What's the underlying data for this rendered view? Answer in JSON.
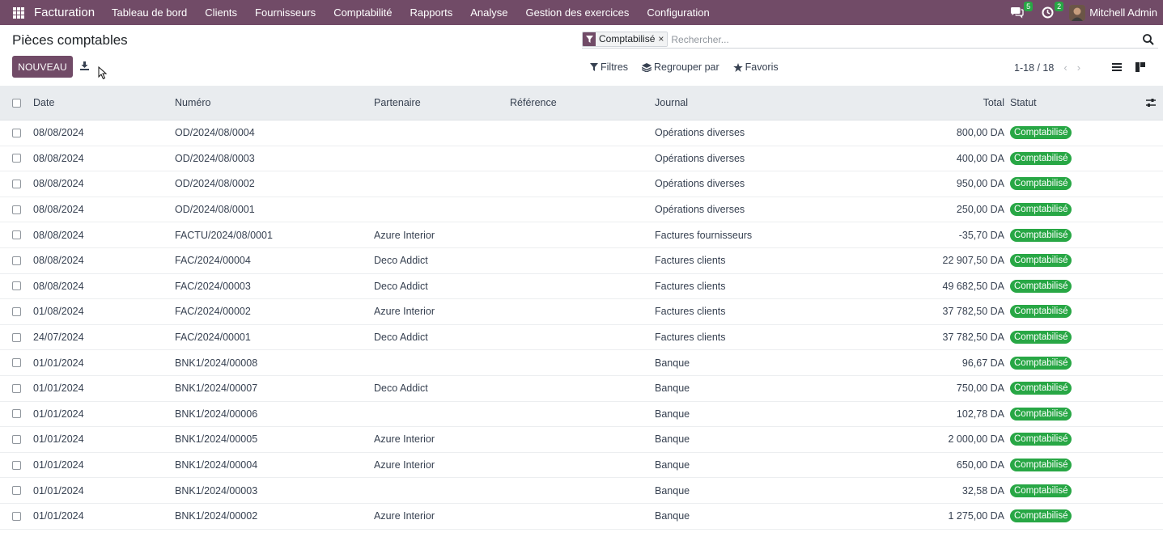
{
  "navbar": {
    "brand": "Facturation",
    "menu": [
      "Tableau de bord",
      "Clients",
      "Fournisseurs",
      "Comptabilité",
      "Rapports",
      "Analyse",
      "Gestion des exercices",
      "Configuration"
    ],
    "messages_count": "5",
    "activities_count": "2",
    "user": "Mitchell Admin"
  },
  "page": {
    "title": "Pièces comptables",
    "new_button": "NOUVEAU"
  },
  "search": {
    "facet_label": "Comptabilisé",
    "facet_remove": "×",
    "placeholder": "Rechercher..."
  },
  "toolbar": {
    "filters": "Filtres",
    "group_by": "Regrouper par",
    "favorites": "Favoris"
  },
  "pager": {
    "value": "1-18 / 18"
  },
  "table": {
    "headers": {
      "date": "Date",
      "number": "Numéro",
      "partner": "Partenaire",
      "reference": "Référence",
      "journal": "Journal",
      "total": "Total",
      "status": "Statut"
    },
    "rows": [
      {
        "date": "08/08/2024",
        "number": "OD/2024/08/0004",
        "partner": "",
        "reference": "",
        "journal": "Opérations diverses",
        "total": "800,00 DA",
        "status": "Comptabilisé"
      },
      {
        "date": "08/08/2024",
        "number": "OD/2024/08/0003",
        "partner": "",
        "reference": "",
        "journal": "Opérations diverses",
        "total": "400,00 DA",
        "status": "Comptabilisé"
      },
      {
        "date": "08/08/2024",
        "number": "OD/2024/08/0002",
        "partner": "",
        "reference": "",
        "journal": "Opérations diverses",
        "total": "950,00 DA",
        "status": "Comptabilisé"
      },
      {
        "date": "08/08/2024",
        "number": "OD/2024/08/0001",
        "partner": "",
        "reference": "",
        "journal": "Opérations diverses",
        "total": "250,00 DA",
        "status": "Comptabilisé"
      },
      {
        "date": "08/08/2024",
        "number": "FACTU/2024/08/0001",
        "partner": "Azure Interior",
        "reference": "",
        "journal": "Factures fournisseurs",
        "total": "-35,70 DA",
        "status": "Comptabilisé"
      },
      {
        "date": "08/08/2024",
        "number": "FAC/2024/00004",
        "partner": "Deco Addict",
        "reference": "",
        "journal": "Factures clients",
        "total": "22 907,50 DA",
        "status": "Comptabilisé"
      },
      {
        "date": "08/08/2024",
        "number": "FAC/2024/00003",
        "partner": "Deco Addict",
        "reference": "",
        "journal": "Factures clients",
        "total": "49 682,50 DA",
        "status": "Comptabilisé"
      },
      {
        "date": "01/08/2024",
        "number": "FAC/2024/00002",
        "partner": "Azure Interior",
        "reference": "",
        "journal": "Factures clients",
        "total": "37 782,50 DA",
        "status": "Comptabilisé"
      },
      {
        "date": "24/07/2024",
        "number": "FAC/2024/00001",
        "partner": "Deco Addict",
        "reference": "",
        "journal": "Factures clients",
        "total": "37 782,50 DA",
        "status": "Comptabilisé"
      },
      {
        "date": "01/01/2024",
        "number": "BNK1/2024/00008",
        "partner": "",
        "reference": "",
        "journal": "Banque",
        "total": "96,67 DA",
        "status": "Comptabilisé"
      },
      {
        "date": "01/01/2024",
        "number": "BNK1/2024/00007",
        "partner": "Deco Addict",
        "reference": "",
        "journal": "Banque",
        "total": "750,00 DA",
        "status": "Comptabilisé"
      },
      {
        "date": "01/01/2024",
        "number": "BNK1/2024/00006",
        "partner": "",
        "reference": "",
        "journal": "Banque",
        "total": "102,78 DA",
        "status": "Comptabilisé"
      },
      {
        "date": "01/01/2024",
        "number": "BNK1/2024/00005",
        "partner": "Azure Interior",
        "reference": "",
        "journal": "Banque",
        "total": "2 000,00 DA",
        "status": "Comptabilisé"
      },
      {
        "date": "01/01/2024",
        "number": "BNK1/2024/00004",
        "partner": "Azure Interior",
        "reference": "",
        "journal": "Banque",
        "total": "650,00 DA",
        "status": "Comptabilisé"
      },
      {
        "date": "01/01/2024",
        "number": "BNK1/2024/00003",
        "partner": "",
        "reference": "",
        "journal": "Banque",
        "total": "32,58 DA",
        "status": "Comptabilisé"
      },
      {
        "date": "01/01/2024",
        "number": "BNK1/2024/00002",
        "partner": "Azure Interior",
        "reference": "",
        "journal": "Banque",
        "total": "1 275,00 DA",
        "status": "Comptabilisé"
      }
    ]
  },
  "colors": {
    "brand": "#714B67",
    "status_green": "#28a745",
    "header_bg": "#e9ecef"
  },
  "icons": {
    "apps": "apps-grid-icon",
    "messages": "chat-icon",
    "activities": "clock-icon",
    "download": "download-icon",
    "filter": "filter-icon",
    "group": "layers-icon",
    "favorites": "star-icon",
    "list_view": "list-view-icon",
    "kanban_view": "kanban-view-icon",
    "optional_columns": "sliders-icon",
    "search": "search-icon"
  }
}
